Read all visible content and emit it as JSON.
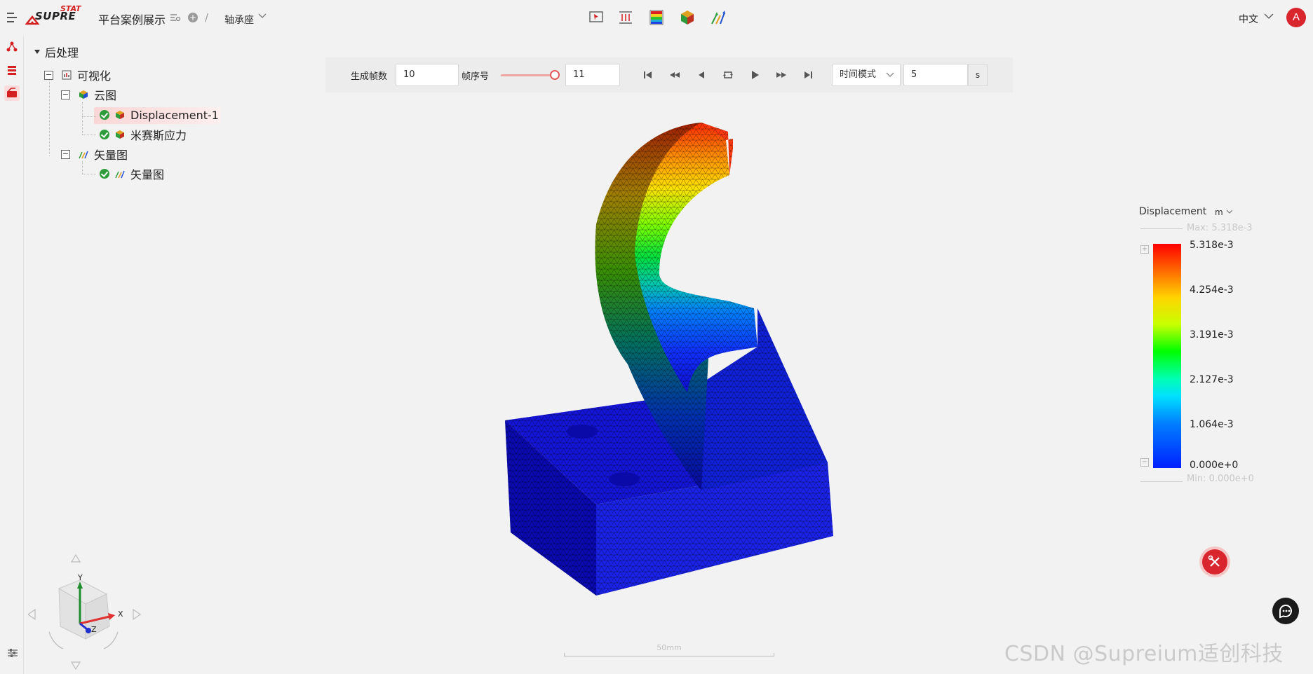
{
  "header": {
    "logo_text": "SUPRE",
    "logo_accent": "STAT",
    "project_title": "平台案例展示",
    "breadcrumb_sep": "/",
    "model_name": "轴承座",
    "language": "中文",
    "avatar_initial": "A",
    "toolbar_icons": [
      "probe-icon",
      "section-icon",
      "contour-bar-icon",
      "cube-result-icon",
      "vector-icon"
    ]
  },
  "rail": {
    "items": [
      "structure-icon",
      "layers-icon",
      "postprocess-icon"
    ],
    "active_index": 2,
    "bottom_icon": "sliders-icon"
  },
  "tree": {
    "root": "后处理",
    "visualization": "可视化",
    "contour_group": "云图",
    "contour_items": [
      "Displacement-1",
      "米赛斯应力"
    ],
    "selected_item": "Displacement-1",
    "vector_group": "矢量图",
    "vector_items": [
      "矢量图"
    ]
  },
  "animation": {
    "frames_label": "生成帧数",
    "frames_value": "10",
    "frame_index_label": "帧序号",
    "frame_index_value": "11",
    "slider_fraction": 1.0,
    "buttons": [
      "first-frame-icon",
      "fast-rewind-icon",
      "step-back-icon",
      "loop-icon",
      "play-icon",
      "fast-forward-icon",
      "last-frame-icon"
    ],
    "mode": "时间模式",
    "duration_value": "5",
    "duration_unit": "s"
  },
  "legend": {
    "title": "Displacement",
    "unit": "m",
    "max_label": "Max: 5.318e-3",
    "min_label": "Min: 0.000e+0",
    "ticks": [
      "5.318e-3",
      "4.254e-3",
      "3.191e-3",
      "2.127e-3",
      "1.064e-3",
      "0.000e+0"
    ],
    "colors": {
      "high": "#ff0000",
      "mid": "#00ff00",
      "low": "#0020ff"
    }
  },
  "viewport": {
    "scale_label": "50mm",
    "axes": {
      "x": "X",
      "y": "Y",
      "z": "Z"
    }
  },
  "accent_color": "#d9252e",
  "watermark": "CSDN @Supreium适创科技"
}
